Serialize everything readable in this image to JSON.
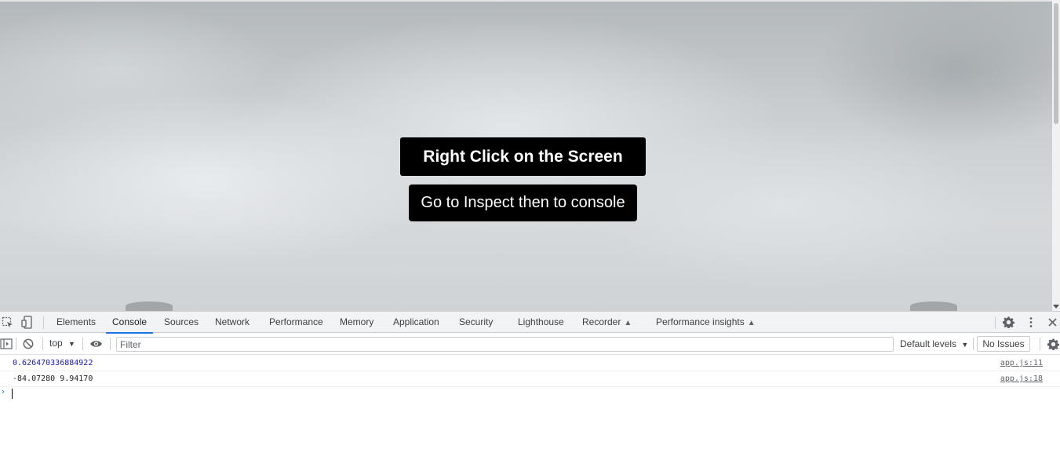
{
  "page": {
    "primary_button": "Right Click on the Screen",
    "secondary_button": "Go to Inspect then to console"
  },
  "devtools": {
    "tabs": [
      {
        "label": "Elements"
      },
      {
        "label": "Console",
        "active": true
      },
      {
        "label": "Sources"
      },
      {
        "label": "Network"
      },
      {
        "label": "Performance"
      },
      {
        "label": "Memory"
      },
      {
        "label": "Application"
      },
      {
        "label": "Security"
      },
      {
        "label": "Lighthouse"
      },
      {
        "label": "Recorder"
      },
      {
        "label": "Performance insights"
      }
    ],
    "icons": {
      "inspect": "inspect-element-icon",
      "device": "device-toolbar-icon",
      "settings": "gear-icon",
      "more": "more-vertical-icon",
      "close": "close-icon"
    },
    "console": {
      "context": "top",
      "filter_placeholder": "Filter",
      "levels": "Default levels",
      "issues": "No Issues"
    },
    "logs": [
      {
        "text": "0.626470336884922",
        "source": "app.js:11",
        "color": "#1a1aa6"
      },
      {
        "text": "-84.07280 9.94170",
        "source": "app.js:18",
        "color": "#222222"
      }
    ],
    "accent_color": "#1a73e8"
  }
}
